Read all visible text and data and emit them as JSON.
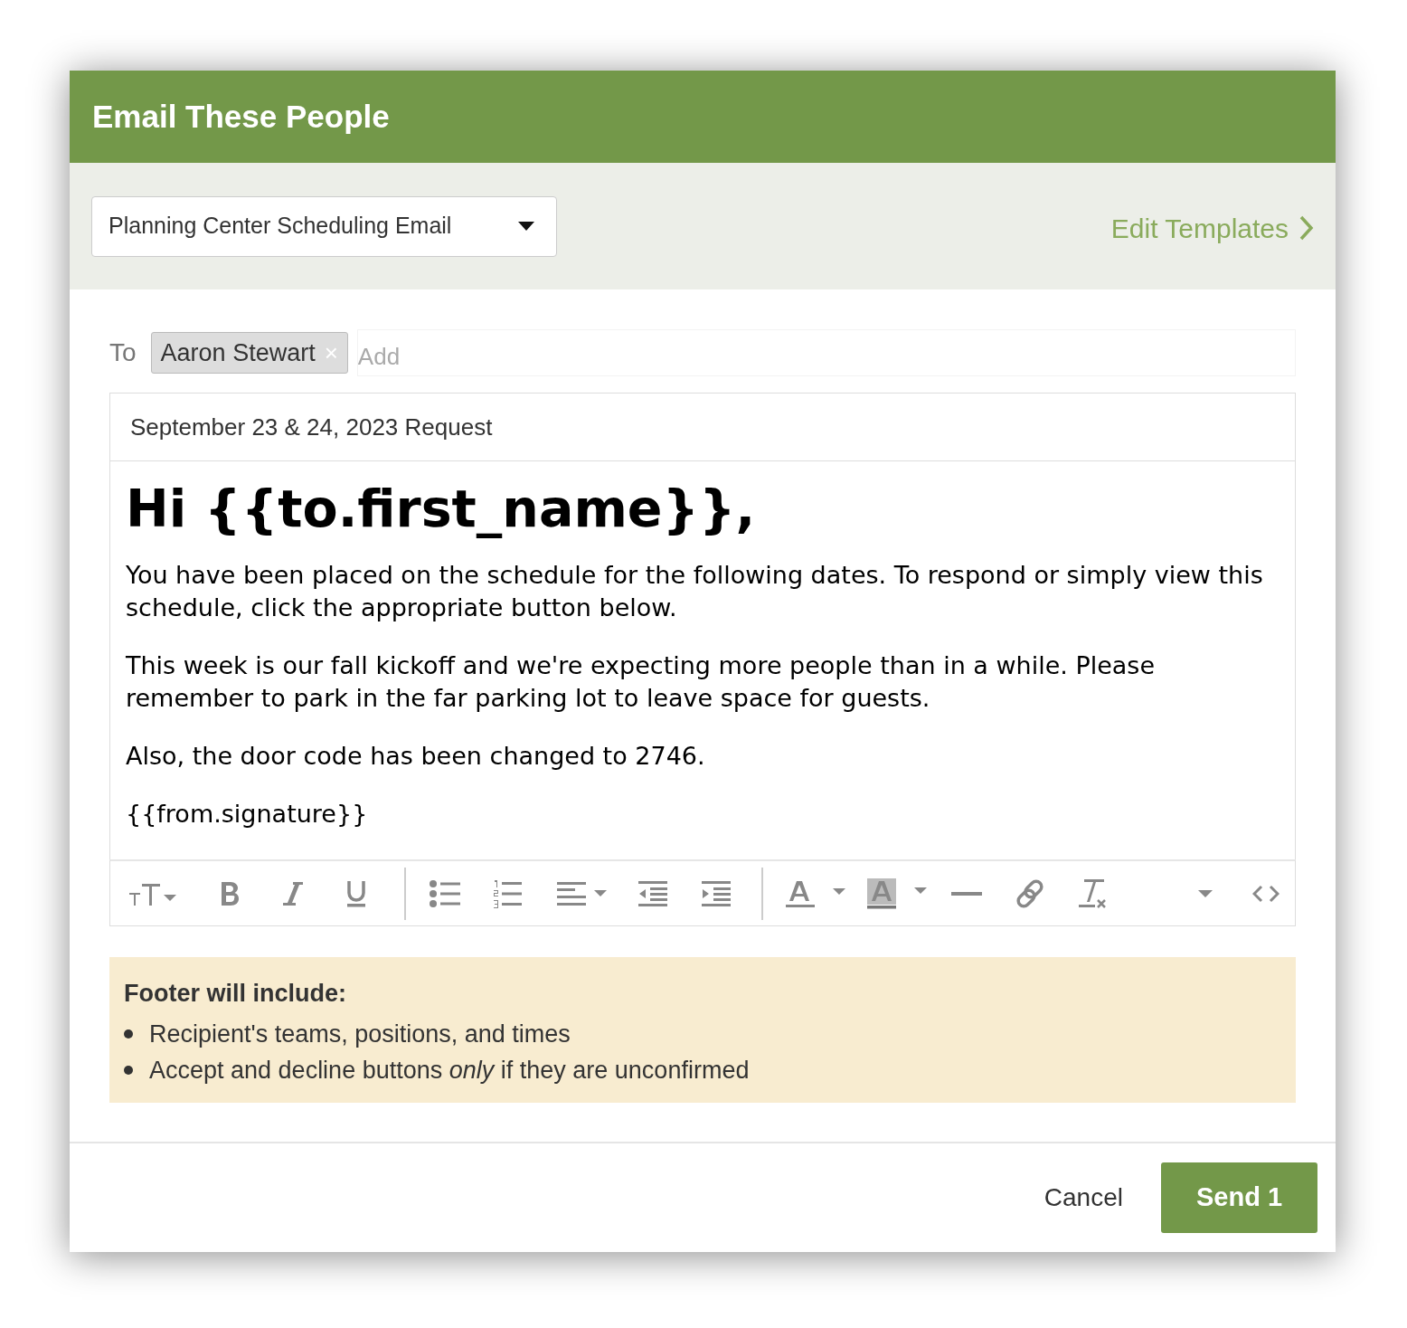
{
  "dialog": {
    "title": "Email These People"
  },
  "template_select": {
    "value": "Planning Center Scheduling Email"
  },
  "edit_templates_link": "Edit Templates",
  "to": {
    "label": "To",
    "recipients": [
      {
        "name": "Aaron Stewart",
        "remove": "×"
      }
    ],
    "placeholder": "Add"
  },
  "subject": "September 23 & 24, 2023 Request",
  "body": [
    {
      "kind": "heading",
      "text": "Hi {{to.first_name}},"
    },
    {
      "kind": "paragraph",
      "text": "You have been placed on the schedule for the following dates. To respond or simply view this schedule, click the appropriate button below."
    },
    {
      "kind": "paragraph",
      "text": "This week is our fall kickoff and we're expecting more people than in a while. Please remember to park in the far parking lot to leave space for guests."
    },
    {
      "kind": "paragraph",
      "text": "Also, the door code has been changed to 2746."
    },
    {
      "kind": "paragraph",
      "text": "{{from.signature}}"
    }
  ],
  "footer_note": {
    "title": "Footer will include:",
    "items": [
      "Recipient's teams, positions, and times",
      "Accept and decline buttons *only* if they are unconfirmed"
    ]
  },
  "buttons": {
    "cancel": "Cancel",
    "send": "Send 1"
  }
}
